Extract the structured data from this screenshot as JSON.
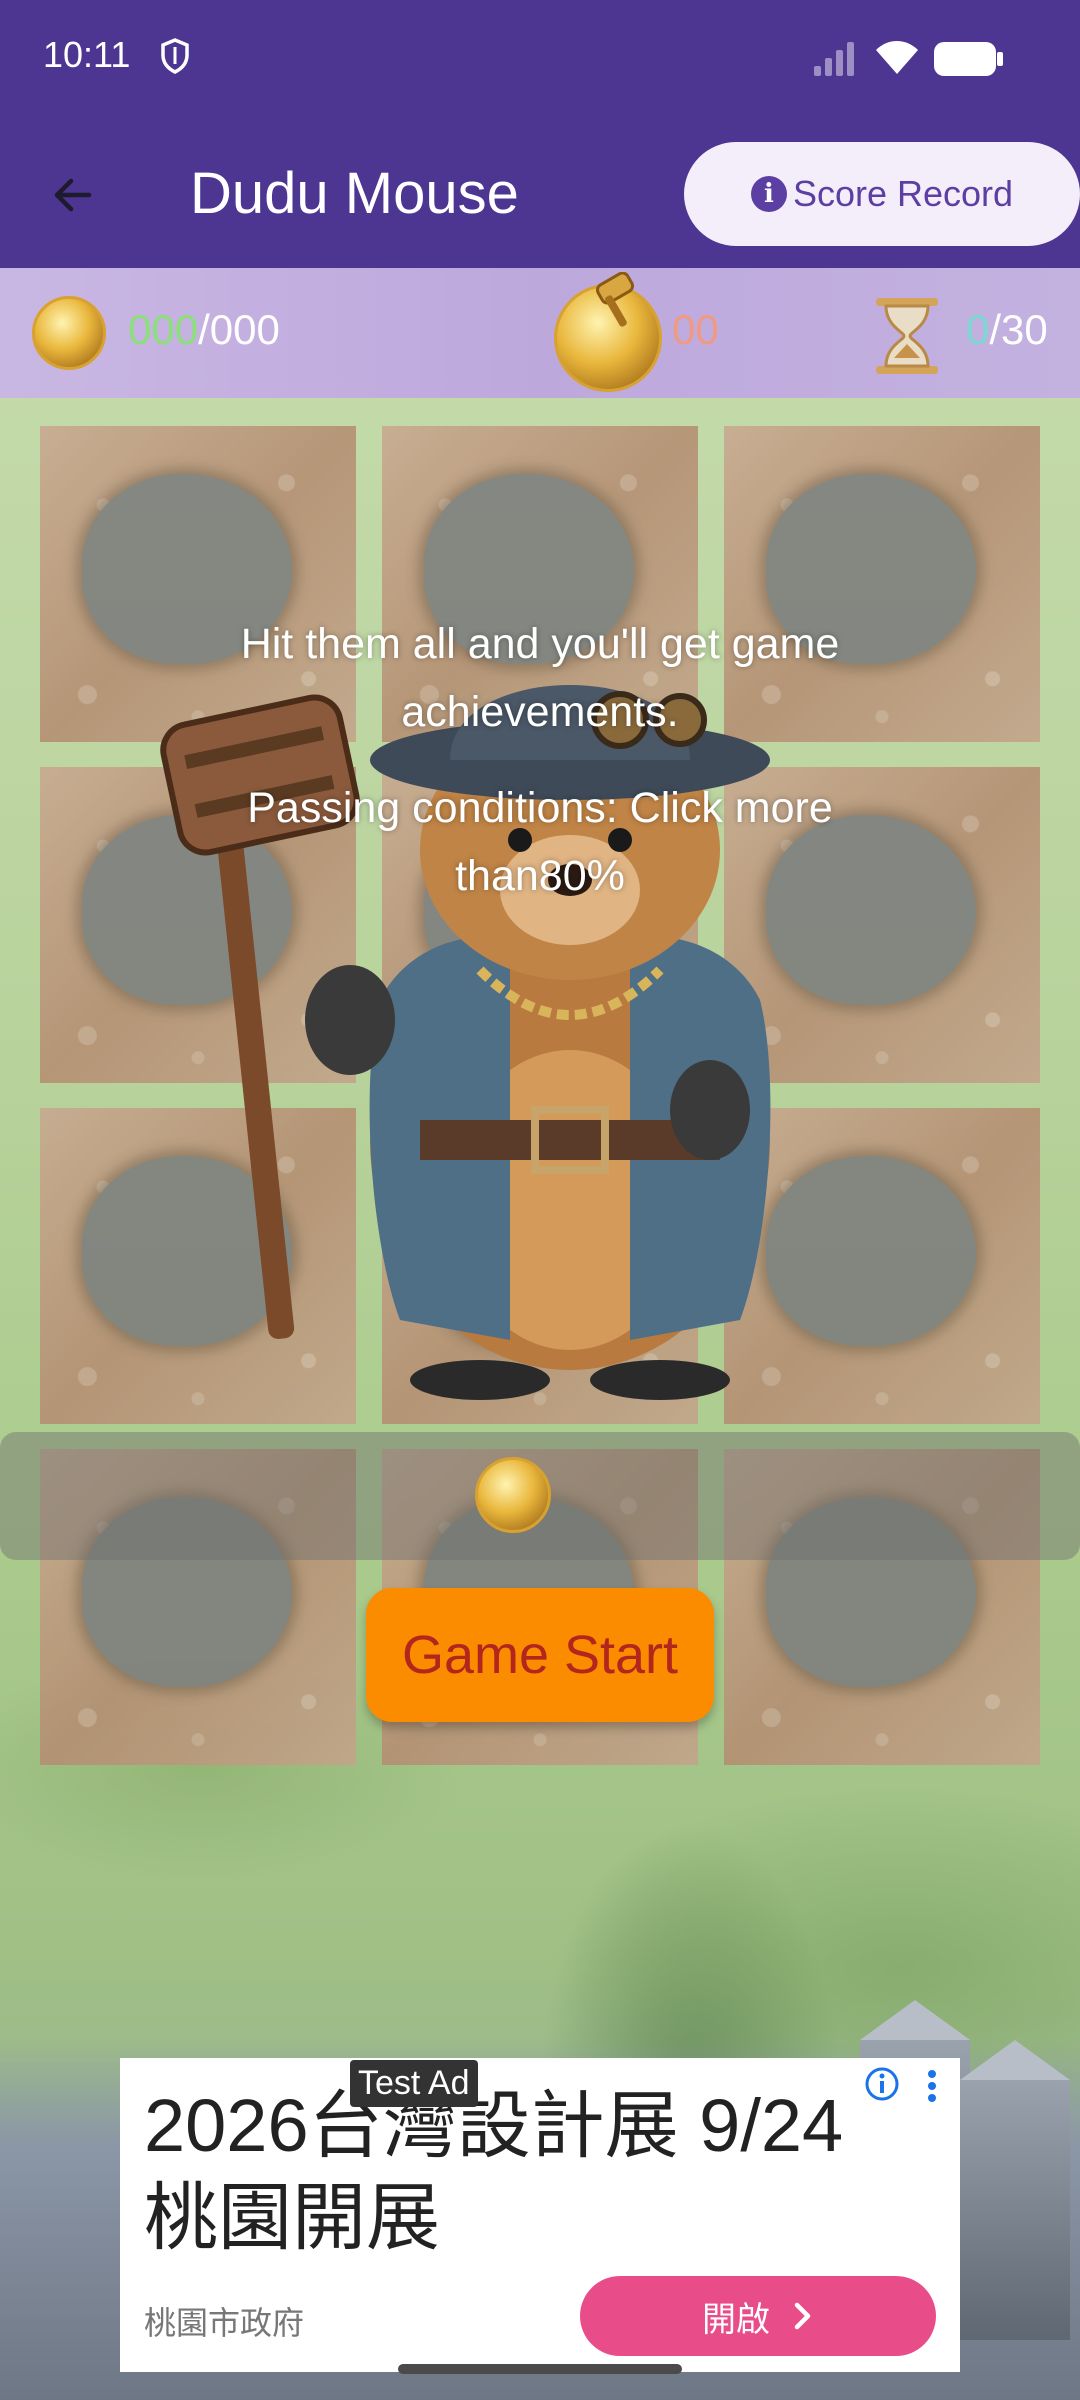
{
  "status": {
    "time": "10:11"
  },
  "appbar": {
    "title": "Dudu Mouse",
    "score_record_label": "Score Record"
  },
  "stats": {
    "score_current": "000",
    "score_total": "/000",
    "hits": "00",
    "time_current": "0",
    "time_total": "/30"
  },
  "game": {
    "message_line1": "Hit them all and you'll get game achievements.",
    "message_line2": "Passing conditions: Click more than80%",
    "start_label": "Game Start"
  },
  "ad": {
    "tag": "Test Ad",
    "headline": "2026台灣設計展 9/24 桃園開展",
    "advertiser": "桃園市政府",
    "cta": "開啟"
  },
  "colors": {
    "appbar": "#4d3592",
    "score_button_bg": "#f4eefa",
    "start_button": "#fb8c00",
    "start_text": "#b3261e",
    "ad_cta": "#e84d8a"
  }
}
